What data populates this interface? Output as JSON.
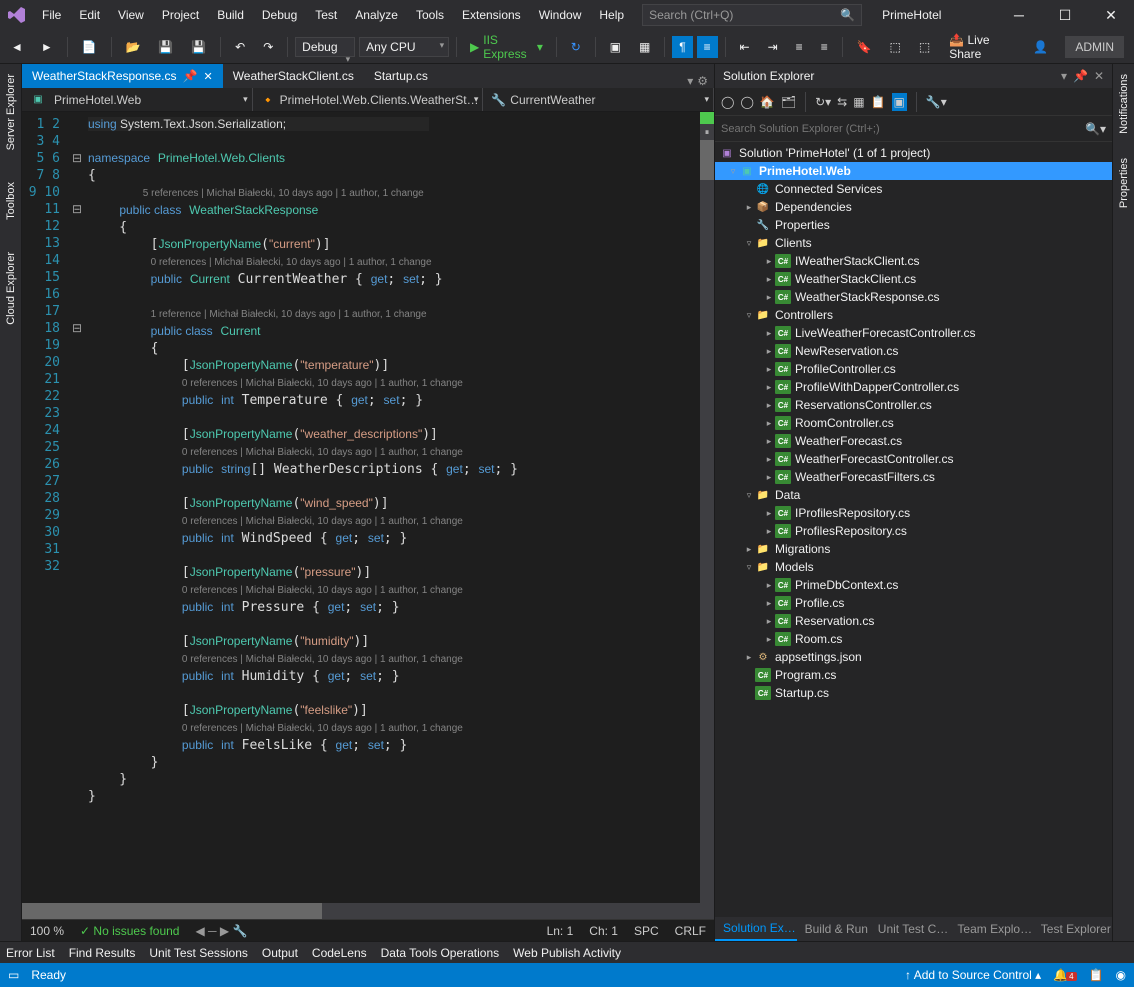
{
  "title": {
    "solution_name": "PrimeHotel",
    "admin": "ADMIN",
    "live_share": "Live Share"
  },
  "menu": [
    "File",
    "Edit",
    "View",
    "Project",
    "Build",
    "Debug",
    "Test",
    "Analyze",
    "Tools",
    "Extensions",
    "Window",
    "Help"
  ],
  "search": {
    "placeholder": "Search (Ctrl+Q)"
  },
  "toolbar": {
    "config": "Debug",
    "platform": "Any CPU",
    "run": "IIS Express"
  },
  "side_tabs_left": [
    "Server Explorer",
    "Toolbox",
    "Cloud Explorer"
  ],
  "side_tabs_right": [
    "Notifications",
    "Properties"
  ],
  "doc_tabs": [
    {
      "label": "WeatherStackResponse.cs",
      "active": true
    },
    {
      "label": "WeatherStackClient.cs",
      "active": false
    },
    {
      "label": "Startup.cs",
      "active": false
    }
  ],
  "nav": {
    "proj": "PrimeHotel.Web",
    "cls": "PrimeHotel.Web.Clients.WeatherSt…",
    "mem": "CurrentWeather"
  },
  "codelens": {
    "a": "5 references | Michał Białecki, 10 days ago | 1 author, 1 change",
    "b": "0 references | Michał Białecki, 10 days ago | 1 author, 1 change",
    "c": "1 reference | Michał Białecki, 10 days ago | 1 author, 1 change"
  },
  "editor_status": {
    "zoom": "100 %",
    "issues": "No issues found",
    "ln": "Ln: 1",
    "ch": "Ch: 1",
    "spc": "SPC",
    "crlf": "CRLF"
  },
  "solution_explorer": {
    "title": "Solution Explorer",
    "search_placeholder": "Search Solution Explorer (Ctrl+;)",
    "root": "Solution 'PrimeHotel' (1 of 1 project)",
    "project": "PrimeHotel.Web",
    "nodes": {
      "connected": "Connected Services",
      "deps": "Dependencies",
      "props": "Properties",
      "clients": "Clients",
      "controllers": "Controllers",
      "data": "Data",
      "migrations": "Migrations",
      "models": "Models"
    },
    "clients": [
      "IWeatherStackClient.cs",
      "WeatherStackClient.cs",
      "WeatherStackResponse.cs"
    ],
    "controllers": [
      "LiveWeatherForecastController.cs",
      "NewReservation.cs",
      "ProfileController.cs",
      "ProfileWithDapperController.cs",
      "ReservationsController.cs",
      "RoomController.cs",
      "WeatherForecast.cs",
      "WeatherForecastController.cs",
      "WeatherForecastFilters.cs"
    ],
    "data_files": [
      "IProfilesRepository.cs",
      "ProfilesRepository.cs"
    ],
    "models": [
      "PrimeDbContext.cs",
      "Profile.cs",
      "Reservation.cs",
      "Room.cs"
    ],
    "root_files": [
      "appsettings.json",
      "Program.cs",
      "Startup.cs"
    ],
    "tabs": [
      "Solution Ex…",
      "Build & Run",
      "Unit Test C…",
      "Team Explo…",
      "Test Explorer"
    ]
  },
  "bottom_tabs": [
    "Error List",
    "Find Results",
    "Unit Test Sessions",
    "Output",
    "CodeLens",
    "Data Tools Operations",
    "Web Publish Activity"
  ],
  "status": {
    "ready": "Ready",
    "src": "Add to Source Control",
    "notif": "4"
  }
}
